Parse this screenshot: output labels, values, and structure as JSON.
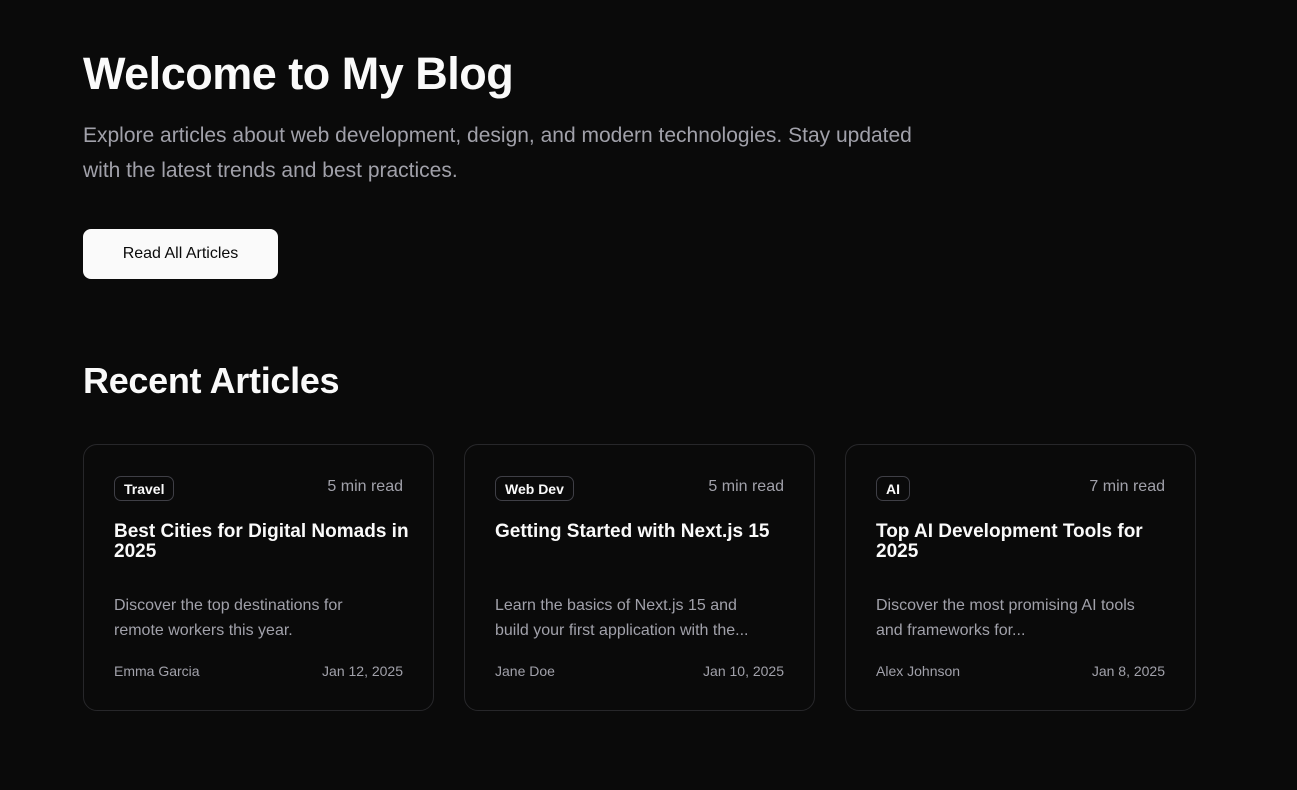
{
  "hero": {
    "title": "Welcome to My Blog",
    "description": "Explore articles about web development, design, and modern technologies. Stay updated with the latest trends and best practices.",
    "cta_label": "Read All Articles"
  },
  "recent": {
    "title": "Recent Articles",
    "articles": [
      {
        "category": "Travel",
        "read_time": "5 min read",
        "title": "Best Cities for Digital Nomads in 2025",
        "excerpt": "Discover the top destinations for remote workers this year.",
        "author": "Emma Garcia",
        "date": "Jan 12, 2025"
      },
      {
        "category": "Web Dev",
        "read_time": "5 min read",
        "title": "Getting Started with Next.js 15",
        "excerpt": "Learn the basics of Next.js 15 and build your first application with the...",
        "author": "Jane Doe",
        "date": "Jan 10, 2025"
      },
      {
        "category": "AI",
        "read_time": "7 min read",
        "title": "Top AI Development Tools for 2025",
        "excerpt": "Discover the most promising AI tools and frameworks for...",
        "author": "Alex Johnson",
        "date": "Jan 8, 2025"
      }
    ]
  },
  "colors": {
    "background": "#0a0a0a",
    "foreground": "#fafafa",
    "muted": "#a1a1aa",
    "border": "#27272a"
  }
}
